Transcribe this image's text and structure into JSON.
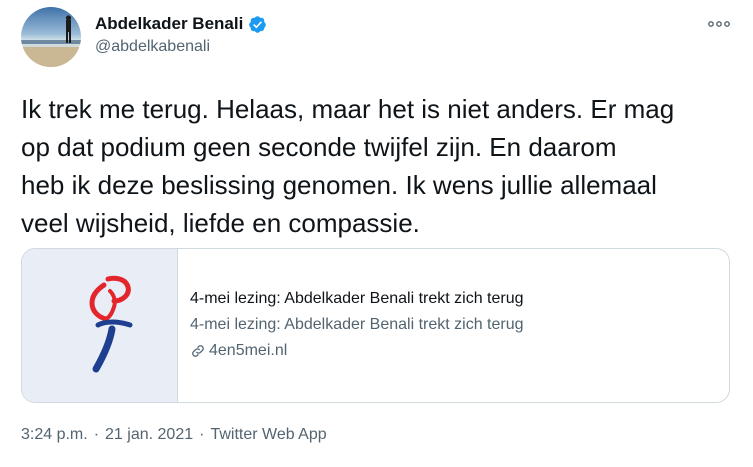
{
  "author": {
    "name": "Abdelkader Benali",
    "handle": "@abdelkabenali",
    "verified": true
  },
  "icons": {
    "avatar": "avatar",
    "verified": "verified-badge-icon",
    "more": "more-options-icon",
    "link": "link-icon",
    "card_logo": "4en5mei-torch-logo"
  },
  "tweet": {
    "text": "Ik trek me terug. Helaas, maar het is niet anders. Er mag\nop dat podium geen seconde twijfel zijn. En daarom\nheb ik deze beslissing genomen. Ik wens jullie allemaal\nveel wijsheid, liefde en compassie."
  },
  "card": {
    "title": "4-mei lezing: Abdelkader Benali trekt zich terug",
    "description": "4-mei lezing: Abdelkader Benali trekt zich terug",
    "domain": "4en5mei.nl"
  },
  "meta": {
    "time": "3:24 p.m.",
    "separator": "·",
    "date": "21 jan. 2021",
    "source": "Twitter Web App"
  },
  "colors": {
    "text": "#0f1419",
    "secondary": "#536471",
    "border": "#cfd9de",
    "verified": "#1d9bf0",
    "logo_red": "#e2262b",
    "logo_blue": "#1e3f8f"
  }
}
